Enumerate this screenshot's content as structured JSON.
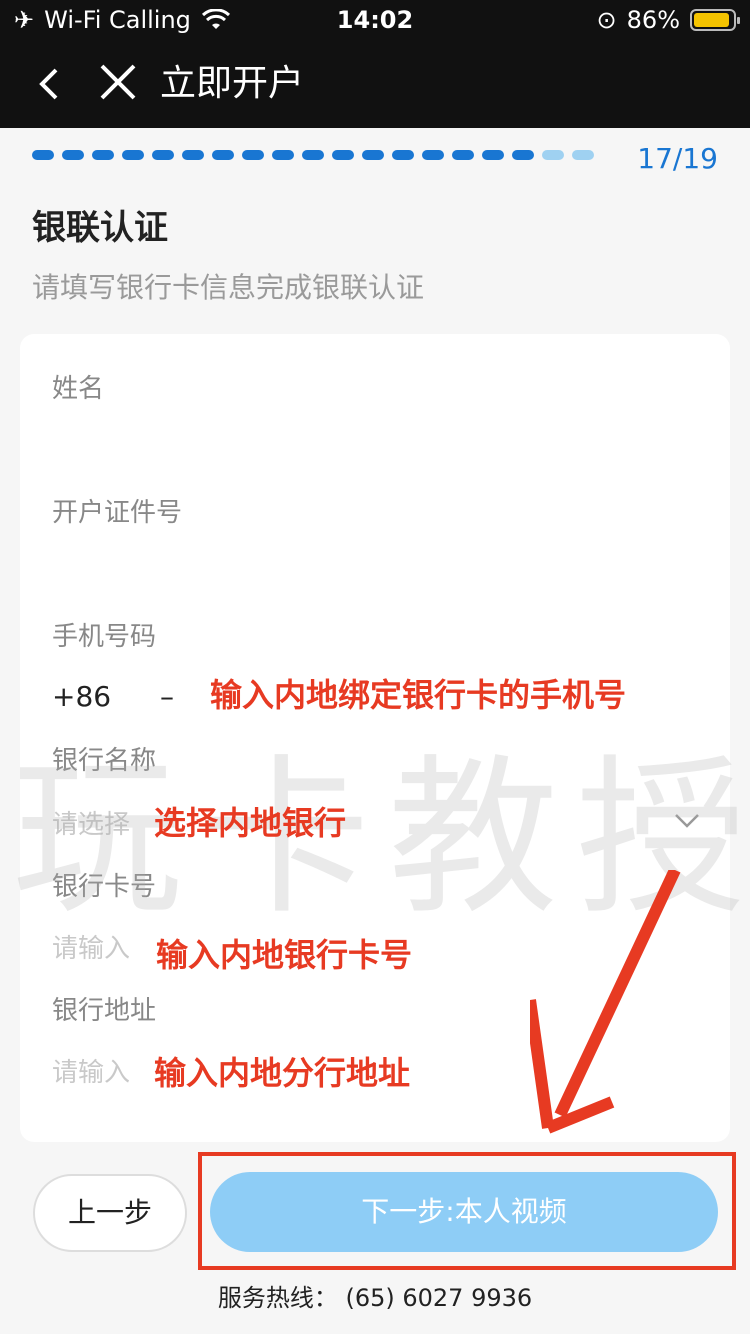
{
  "status_bar": {
    "carrier": "Wi-Fi Calling",
    "time": "14:02",
    "battery": "86%",
    "battery_level": 0.86
  },
  "nav": {
    "title": "立即开户",
    "back_icon": "chevron-left-icon",
    "close_icon": "close-icon"
  },
  "progress": {
    "label": "17/19",
    "current": 17,
    "total": 19
  },
  "section": {
    "title": "银联认证",
    "subtitle": "请填写银行卡信息完成银联认证"
  },
  "form": {
    "name_label": "姓名",
    "id_label": "开户证件号",
    "phone_label": "手机号码",
    "phone_prefix": "+86",
    "phone_dash": "–",
    "bank_name_label": "银行名称",
    "bank_name_placeholder": "请选择",
    "card_no_label": "银行卡号",
    "card_no_placeholder": "请输入",
    "bank_address_label": "银行地址",
    "bank_address_placeholder": "请输入"
  },
  "annotations": {
    "phone": "输入内地绑定银行卡的手机号",
    "bank": "选择内地银行",
    "card": "输入内地银行卡号",
    "address": "输入内地分行地址"
  },
  "watermark": "玩卡教授",
  "buttons": {
    "prev": "上一步",
    "next": "下一步:本人视频"
  },
  "hotline": "服务热线： (65) 6027 9936",
  "colors": {
    "accent": "#1976d2",
    "next_button": "#8ecdf6",
    "annotation": "#e73a22"
  }
}
